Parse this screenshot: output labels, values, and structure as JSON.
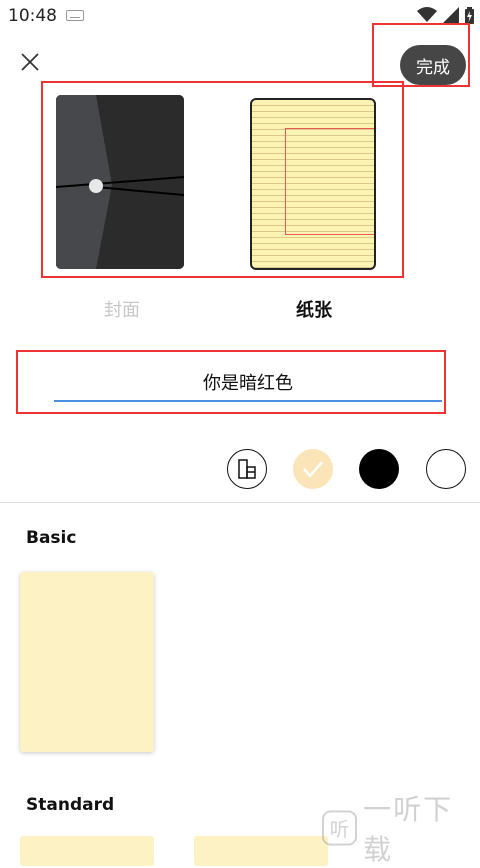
{
  "status_bar": {
    "time": "10:48"
  },
  "header": {
    "done_label": "完成"
  },
  "preview": {
    "cover_label": "封面",
    "paper_label": "纸张"
  },
  "notebook_name": {
    "value": "你是暗红色"
  },
  "swatches": [
    {
      "name": "pattern",
      "color": "#ffffff"
    },
    {
      "name": "cream",
      "color": "#fbe5b8",
      "selected": true
    },
    {
      "name": "black",
      "color": "#000000"
    },
    {
      "name": "white",
      "color": "#ffffff"
    }
  ],
  "sections": {
    "basic": "Basic",
    "standard": "Standard"
  },
  "watermark": {
    "text": "一听下载"
  },
  "colors": {
    "accent": "#4a90e2",
    "highlight": "#e33333",
    "paper": "#fdf3b3"
  }
}
